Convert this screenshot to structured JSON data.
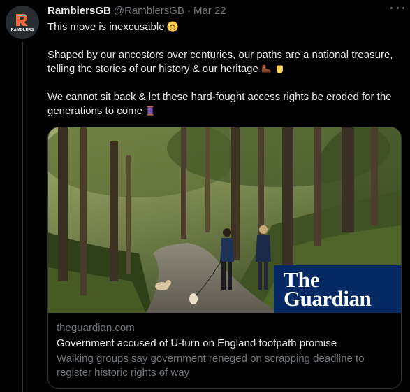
{
  "tweet": {
    "author_name": "RamblersGB",
    "handle": "@RamblersGB",
    "separator": "·",
    "date": "Mar 22",
    "avatar_text": "RAMBLERS",
    "paragraphs": [
      "This move is inexcusable",
      "Shaped by our ancestors over centuries, our paths are a national treasure, telling the stories of our history & our heritage",
      "We cannot sit back & let these hard-fought access rights be eroded for the generations to come"
    ],
    "emojis": [
      "angry-face-icon",
      "hiking-boot-icon",
      "raised-fist-icon",
      "spool-of-thread-icon"
    ]
  },
  "card": {
    "logo_line1": "The",
    "logo_line2": "Guardian",
    "domain": "theguardian.com",
    "title": "Government accused of U-turn on England footpath promise",
    "description": "Walking groups say government reneged on scrapping deadline to register historic rights of way"
  },
  "colors": {
    "background": "#000000",
    "text_primary": "#e7e9ea",
    "text_secondary": "#71767b",
    "border": "#2f3336",
    "guardian_blue": "#052962",
    "ramblers_orange": "#f26b3a",
    "ramblers_teal": "#6ec4b4"
  }
}
